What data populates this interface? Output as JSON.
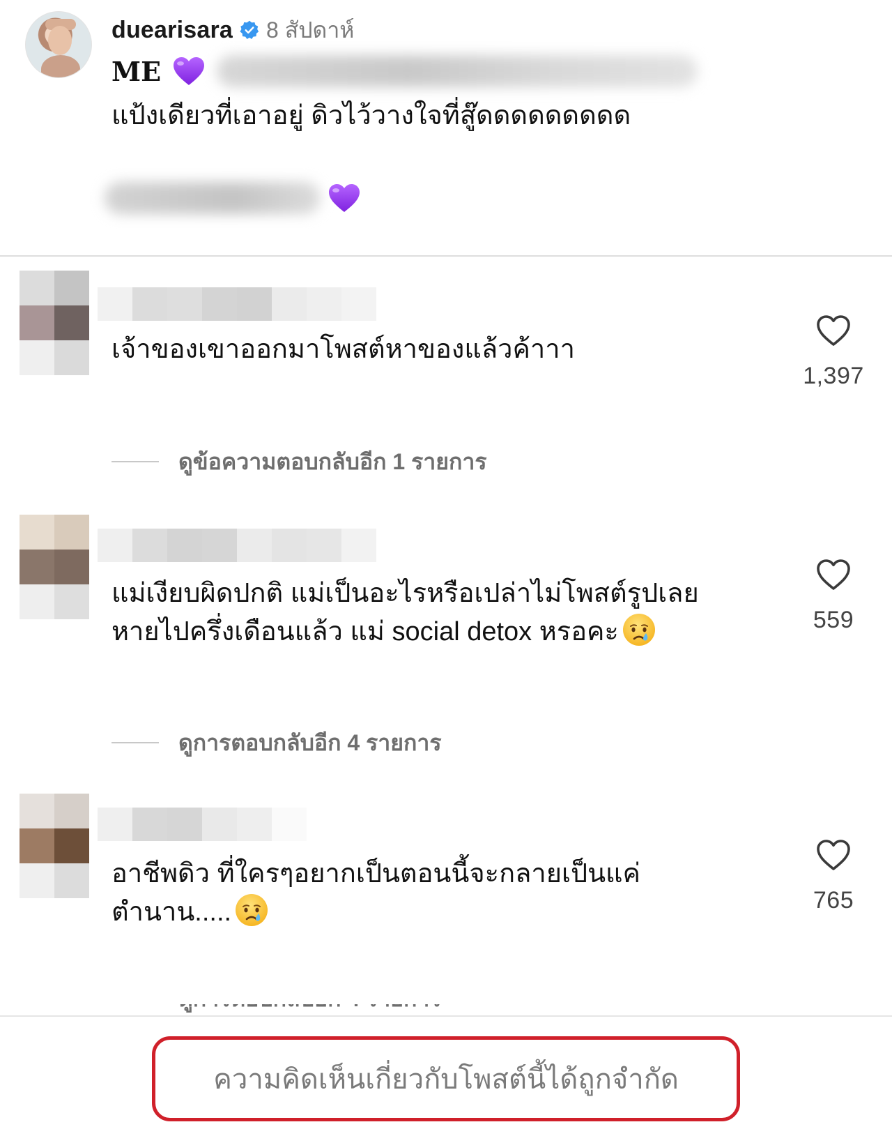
{
  "post": {
    "username": "duearisara",
    "verified": true,
    "time_ago": "8 สัปดาห์",
    "caption": {
      "line1_text": "ME",
      "line2_text": "แป้งเดียวที่เอาอยู่ ดิวไว้วางใจที่สู๊ดดดดดดดดด"
    }
  },
  "comments": [
    {
      "text_lines": [
        "เจ้าของเขาออกมาโพสต์หาของแล้วค้าาา"
      ],
      "likes": "1,397",
      "emoji_end": false,
      "replies_label": "ดูข้อความตอบกลับอีก 1 รายการ"
    },
    {
      "text_lines": [
        "แม่เงียบผิดปกติ แม่เป็นอะไรหรือเปล่าไม่โพสต์รูปเลย",
        "หายไปครึ่งเดือนแล้ว แม่ social detox หรอคะ"
      ],
      "likes": "559",
      "emoji_end": true,
      "replies_label": "ดูการตอบกลับอีก 4 รายการ"
    },
    {
      "text_lines": [
        "อาชีพดิว ที่ใครๆอยากเป็นตอนนี้จะกลายเป็นแค่",
        "ตำนาน....."
      ],
      "likes": "765",
      "emoji_end": true,
      "replies_label": ""
    }
  ],
  "footer": {
    "limited_notice": "ความคิดเห็นเกี่ยวกับโพสต์นี้ได้ถูกจำกัด"
  },
  "colors": {
    "notice_border": "#d0202a",
    "verified_blue": "#3897f0",
    "purple_heart": "#9b3bf0"
  },
  "icons": {
    "verified": "verified-badge-icon",
    "purple_heart": "purple-heart-emoji-icon",
    "crying_face": "crying-face-emoji-icon",
    "like": "heart-outline-icon"
  }
}
